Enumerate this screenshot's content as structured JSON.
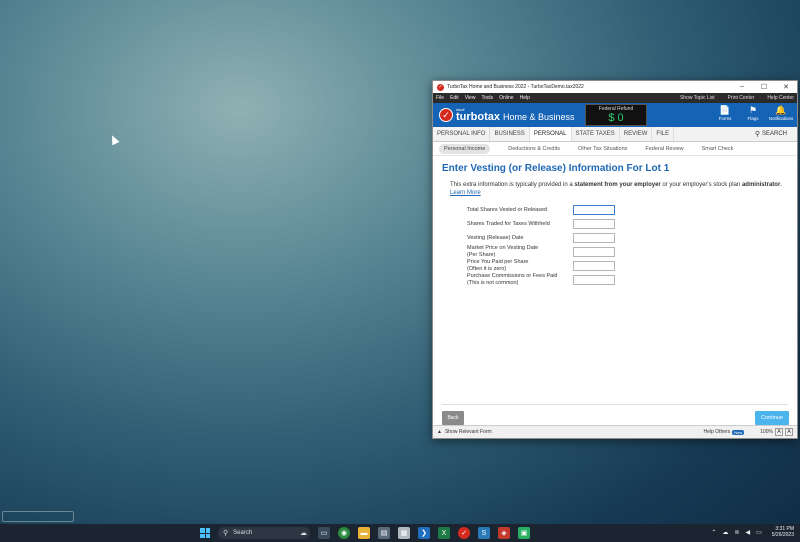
{
  "window": {
    "title": "TurboTax Home and Business 2022 - TurboTaxDemo.tax2022",
    "controls": [
      "–",
      "☐",
      "✕"
    ]
  },
  "menu": {
    "items": [
      "File",
      "Edit",
      "View",
      "Tools",
      "Online",
      "Help"
    ],
    "right": [
      "Show Topic List",
      "Print Center",
      "Help Center"
    ]
  },
  "brand": {
    "intuit": "intuit",
    "product": "turbotax",
    "edition": "Home & Business",
    "refund_label": "Federal Refund",
    "refund_value": "$ 0",
    "tools": [
      {
        "icon": "📄",
        "label": "Forms"
      },
      {
        "icon": "⚑",
        "label": "Flags"
      },
      {
        "icon": "🔔",
        "label": "Notifications"
      }
    ]
  },
  "tabs": [
    "PERSONAL INFO",
    "BUSINESS",
    "PERSONAL",
    "STATE TAXES",
    "REVIEW",
    "FILE"
  ],
  "search_label": "SEARCH",
  "subtabs": [
    "Personal Income",
    "Deductions & Credits",
    "Other Tax Situations",
    "Federal Review",
    "Smart Check"
  ],
  "page": {
    "heading": "Enter Vesting (or Release) Information For Lot 1",
    "intro_1": "This extra information is typically provided in a ",
    "intro_bold_1": "statement from your employer",
    "intro_2": " or your employer's stock plan ",
    "intro_bold_2": "administrator",
    "intro_3": ". ",
    "learn_more": "Learn More",
    "fields": [
      {
        "label": "Total Shares Vested or Released",
        "sub": ""
      },
      {
        "label": "Shares Traded for Taxes Withheld",
        "sub": ""
      },
      {
        "label": "Vesting (Release) Date",
        "sub": ""
      },
      {
        "label": "Market Price on Vesting Date",
        "sub": "(Per Share)"
      },
      {
        "label": "Price You Paid per Share",
        "sub": "(Often it is zero)"
      },
      {
        "label": "Purchase Commissions or Fees Paid",
        "sub": "(This is not common)"
      }
    ],
    "back": "Back",
    "continue": "Continue"
  },
  "status": {
    "show_form": "Show Relevant Form",
    "help_others": "Help Others",
    "badge": "New",
    "zoom": "100%"
  },
  "taskbar": {
    "search": "Search",
    "time": "3:31 PM",
    "date": "5/26/2023"
  }
}
